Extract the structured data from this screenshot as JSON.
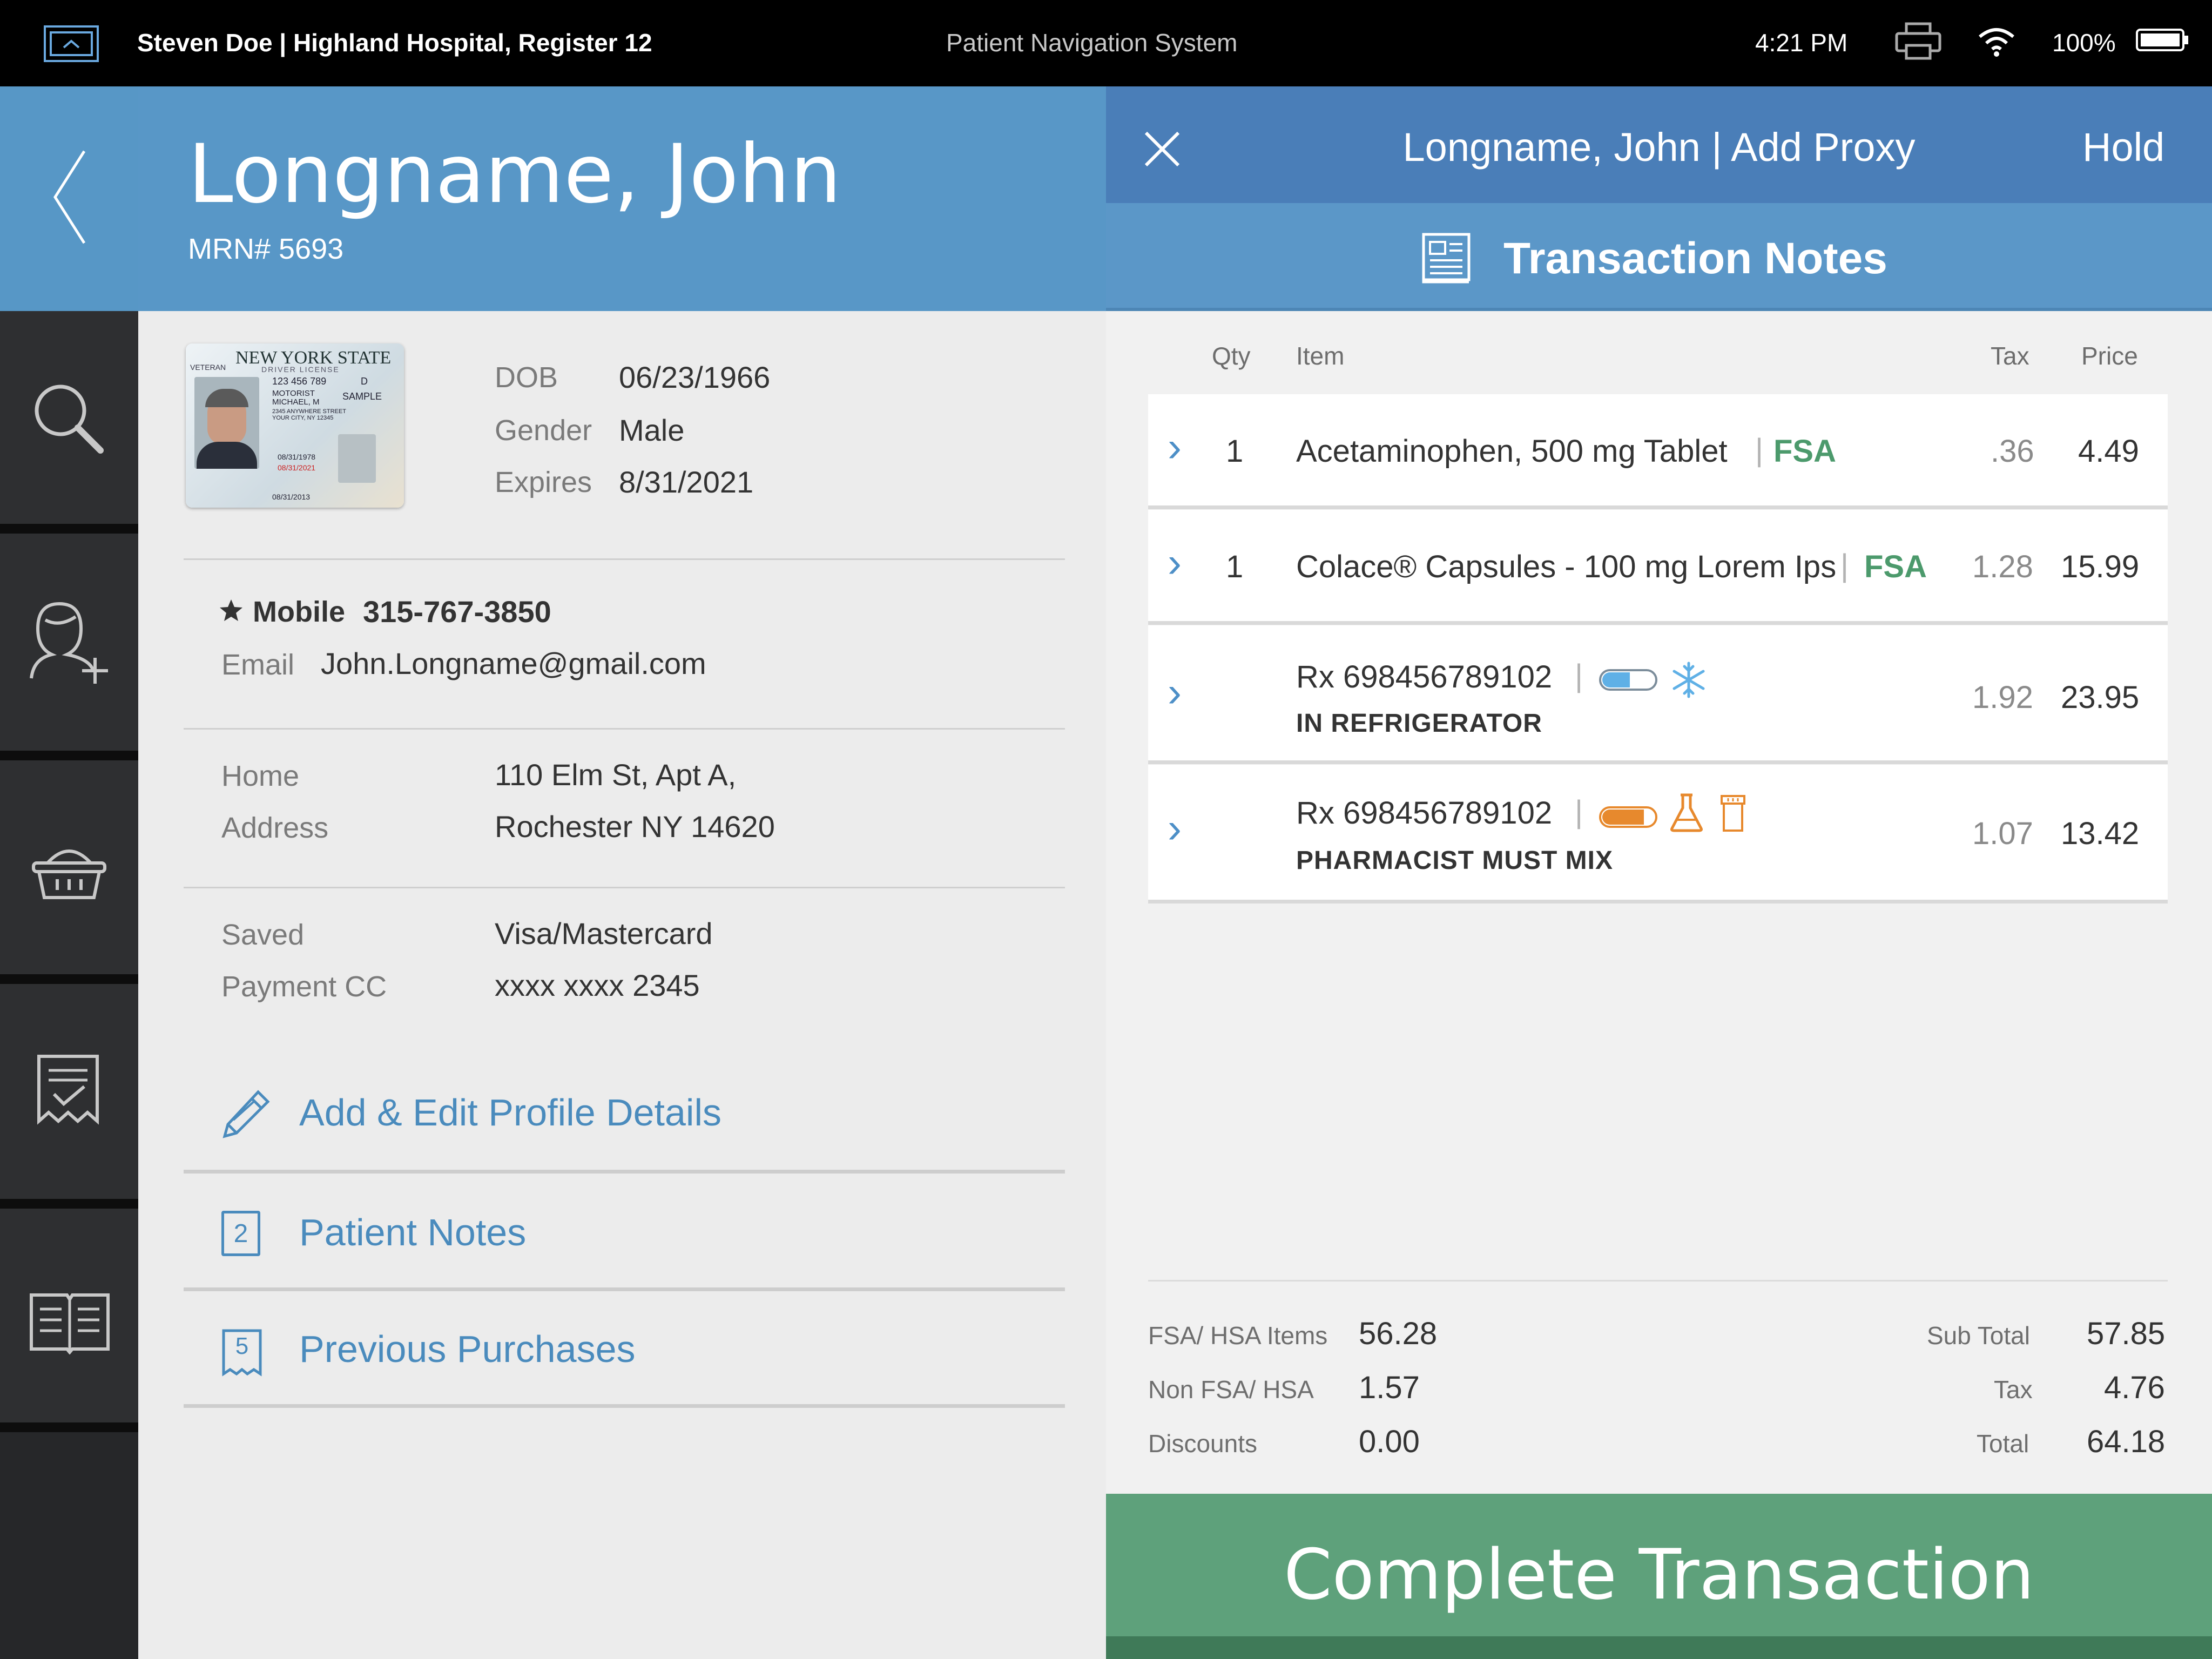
{
  "status_bar": {
    "user_location": "Steven Doe | Highland Hospital, Register 12",
    "app_name": "Patient Navigation System",
    "time": "4:21 PM",
    "battery": "100%"
  },
  "rail": {
    "icons": [
      "back-chevron-icon",
      "search-icon",
      "add-user-icon",
      "basket-icon",
      "receipt-check-icon",
      "book-icon"
    ]
  },
  "patient": {
    "name": "Longname, John",
    "mrn": "MRN# 5693",
    "dob_label": "DOB",
    "dob": "06/23/1966",
    "gender_label": "Gender",
    "gender": "Male",
    "expires_label": "Expires",
    "expires": "8/31/2021",
    "mobile_label": "Mobile",
    "mobile": "315-767-3850",
    "email_label": "Email",
    "email": "John.Longname@gmail.com",
    "home_label_1": "Home",
    "home_label_2": "Address",
    "address_1": "110 Elm St, Apt A,",
    "address_2": "Rochester NY 14620",
    "saved_label_1": "Saved",
    "saved_label_2": "Payment CC",
    "card_type": "Visa/Mastercard",
    "card_number": "xxxx xxxx 2345",
    "links": {
      "edit_profile": "Add & Edit Profile Details",
      "patient_notes": "Patient Notes",
      "patient_notes_count": "2",
      "previous_purchases": "Previous Purchases",
      "previous_purchases_count": "5"
    }
  },
  "license_card": {
    "state": "NEW YORK STATE",
    "type": "DRIVER LICENSE",
    "veteran": "VETERAN",
    "id": "123 456 789",
    "name_1": "MOTORIST",
    "name_2": "MICHAEL, M",
    "street": "2345 ANYWHERE STREET",
    "city": "YOUR CITY, NY 12345",
    "class": "D",
    "sample": "SAMPLE",
    "dob": "08/31/1978",
    "expires": "08/31/2021",
    "issued": "08/31/2013"
  },
  "transaction": {
    "title": "Longname, John | Add Proxy",
    "hold": "Hold",
    "notes_title": "Transaction Notes",
    "columns": {
      "qty": "Qty",
      "item": "Item",
      "tax": "Tax",
      "price": "Price"
    },
    "items": [
      {
        "qty": "1",
        "name": "Acetaminophen, 500 mg Tablet",
        "tag": "FSA",
        "tax": ".36",
        "price": "4.49"
      },
      {
        "qty": "1",
        "name": "Colace® Capsules - 100 mg Lorem Ips",
        "tag": "FSA",
        "tax": "1.28",
        "price": "15.99"
      },
      {
        "qty": "",
        "name": "Rx 698456789102",
        "note": "IN REFRIGERATOR",
        "tax": "1.92",
        "price": "23.95"
      },
      {
        "qty": "",
        "name": "Rx 698456789102",
        "note": "PHARMACIST MUST MIX",
        "tax": "1.07",
        "price": "13.42"
      }
    ],
    "totals": {
      "fsa_label": "FSA/ HSA Items",
      "fsa": "56.28",
      "nonfsa_label": "Non FSA/ HSA",
      "nonfsa": "1.57",
      "disc_label": "Discounts",
      "disc": "0.00",
      "sub_label": "Sub Total",
      "sub": "57.85",
      "tax_label": "Tax",
      "tax": "4.76",
      "total_label": "Total",
      "total": "64.18"
    },
    "complete_label": "Complete Transaction"
  },
  "colors": {
    "header_blue": "#5897c7",
    "dark_blue": "#4a7eb8",
    "accent_green": "#5ea17b",
    "fsa_green": "#4c9a6c",
    "rx_orange": "#e7892d",
    "cold_blue": "#5fb0e6"
  }
}
